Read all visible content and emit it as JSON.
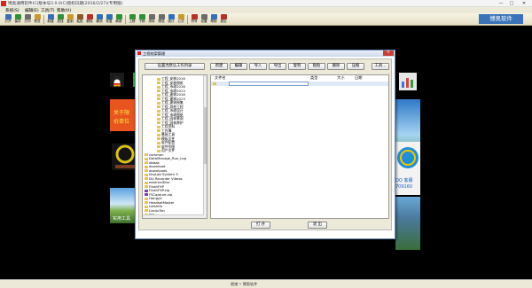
{
  "window": {
    "title": "博奥通用软件(C)版本号2.0.0(C)授权日期(2016/2/27)(专用版)",
    "controls": {
      "minimize": "—",
      "maximize": "□",
      "close": "✕"
    }
  },
  "menu": [
    "系统(S)",
    "编辑(E)",
    "工具(T)",
    "帮助(H)"
  ],
  "toolbar": {
    "buttons": [
      {
        "label": "打开",
        "color": "#3b6fb5"
      },
      {
        "label": "保存",
        "color": "#2f8f3a"
      },
      {
        "label": "打印",
        "color": "#6b6b6b"
      },
      {
        "label": "预览",
        "color": "#c79a2d"
      },
      {
        "label": "新建",
        "color": "#3b6fb5"
      },
      {
        "label": "查找",
        "color": "#2f8f3a"
      },
      {
        "label": "复制",
        "color": "#c79a2d"
      },
      {
        "label": "粘贴",
        "color": "#8a5a2a"
      },
      {
        "label": "删除",
        "color": "#b5302a"
      },
      {
        "label": "撤消",
        "color": "#2f6fb5"
      },
      {
        "label": "恢复",
        "color": "#2f6fb5"
      },
      {
        "label": "刷新",
        "color": "#2f8f3a"
      },
      {
        "label": "上移",
        "color": "#2f8f3a"
      },
      {
        "label": "下移",
        "color": "#2f8f3a"
      },
      {
        "label": "排序",
        "color": "#6b6b6b"
      },
      {
        "label": "筛选",
        "color": "#6b6b6b"
      },
      {
        "label": "统计",
        "color": "#2f6fb5"
      },
      {
        "label": "公式",
        "color": "#c79a2d"
      },
      {
        "label": "符号",
        "color": "#b5302a"
      },
      {
        "label": "设置",
        "color": "#6b6b6b"
      },
      {
        "label": "帮助",
        "color": "#3b6fb5"
      },
      {
        "label": "退出",
        "color": "#b5302a"
      }
    ],
    "brand": "博奥软件"
  },
  "desktop": {
    "tile_promo_line1": "关于限",
    "tile_promo_line2": "价单位",
    "tile_photo_caption": "实用工具",
    "tile_right_qq": "QQ 客服",
    "tile_right_num": "709160"
  },
  "dialog": {
    "title": "工程档案管理",
    "close": "✕",
    "set_dir_button": "设置为默认工作目录",
    "toolbar": [
      "新建",
      "编辑",
      "导入",
      "导出",
      "复制",
      "粘贴",
      "删除",
      "压缩"
    ],
    "tools_button": "工具...",
    "columns": {
      "name": "文件名",
      "type": "类型",
      "size": "大小",
      "date": "日期"
    },
    "tree": [
      {
        "label": "工程_安装2016",
        "kind": "folder"
      },
      {
        "label": "工程_安装图纸",
        "kind": "folder"
      },
      {
        "label": "工程_市政2016",
        "kind": "folder"
      },
      {
        "label": "工程_市政2013",
        "kind": "folder"
      },
      {
        "label": "工程_建筑2016",
        "kind": "folder"
      },
      {
        "label": "工程_建筑2013",
        "kind": "folder"
      },
      {
        "label": "工程_建筑图集",
        "kind": "folder"
      },
      {
        "label": "工程_其他工程",
        "kind": "folder"
      },
      {
        "label": "工程_市政设计",
        "kind": "folder"
      },
      {
        "label": "工程_市政图纸",
        "kind": "folder"
      },
      {
        "label": "工程_园林景观",
        "kind": "folder"
      },
      {
        "label": "工程_园林养护",
        "kind": "folder"
      },
      {
        "label": "工程资料",
        "kind": "folder"
      },
      {
        "label": "工作簿",
        "kind": "folder"
      },
      {
        "label": "基础工具",
        "kind": "folder"
      },
      {
        "label": "模板文件",
        "kind": "folder"
      },
      {
        "label": "软件配置",
        "kind": "folder"
      },
      {
        "label": "软件作图",
        "kind": "folder"
      },
      {
        "label": "用户文件",
        "kind": "folder"
      },
      {
        "label": "common",
        "kind": "folder"
      },
      {
        "label": "DataManage_Run_Log",
        "kind": "folder"
      },
      {
        "label": "dbbak",
        "kind": "folder"
      },
      {
        "label": "download",
        "kind": "folder"
      },
      {
        "label": "downloads",
        "kind": "folder"
      },
      {
        "label": "DrpLab System 5",
        "kind": "folder"
      },
      {
        "label": "DU Recorder Videos",
        "kind": "folder"
      },
      {
        "label": "externalDisc",
        "kind": "folder"
      },
      {
        "label": "FlashFXP",
        "kind": "folder"
      },
      {
        "label": "FlashFXP.zip",
        "kind": "file"
      },
      {
        "label": "FSCapture.zip",
        "kind": "file"
      },
      {
        "label": "Hangye",
        "kind": "folder"
      },
      {
        "label": "HeadsetMaster",
        "kind": "folder"
      },
      {
        "label": "LatsInfo",
        "kind": "folder"
      },
      {
        "label": "LianJuTon",
        "kind": "folder"
      },
      {
        "label": "log",
        "kind": "folder"
      },
      {
        "label": "MyLibDownLoad",
        "kind": "folder"
      }
    ],
    "open_button": "打 开",
    "exit_button": "退 出"
  },
  "status": "就绪 • 博奥软件"
}
